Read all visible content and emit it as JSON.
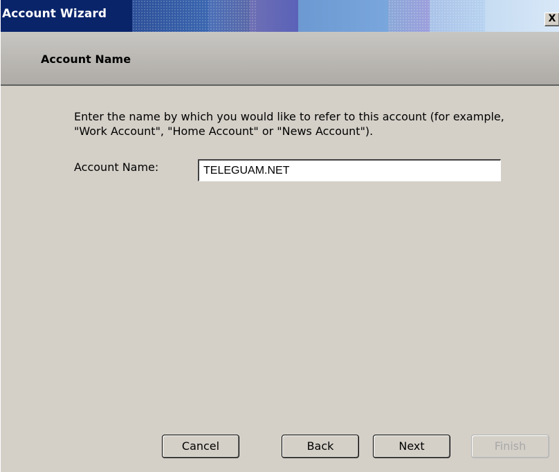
{
  "window": {
    "title": "Account Wizard",
    "close_label": "X"
  },
  "header": {
    "title": "Account Name"
  },
  "main": {
    "description": "Enter the name by which you would like to refer to this account (for example, \"Work Account\", \"Home Account\" or \"News Account\").",
    "account_name_label": "Account Name:",
    "account_name_value": "TELEGUAM.NET"
  },
  "buttons": {
    "cancel": "Cancel",
    "back": "Back",
    "next": "Next",
    "finish": "Finish",
    "finish_enabled": false
  },
  "colors": {
    "title_bar_start": "#0a246a",
    "dialog_background": "#d4d0c8",
    "header_background": "#aeaba6",
    "disabled_text": "#a8a8a8"
  }
}
